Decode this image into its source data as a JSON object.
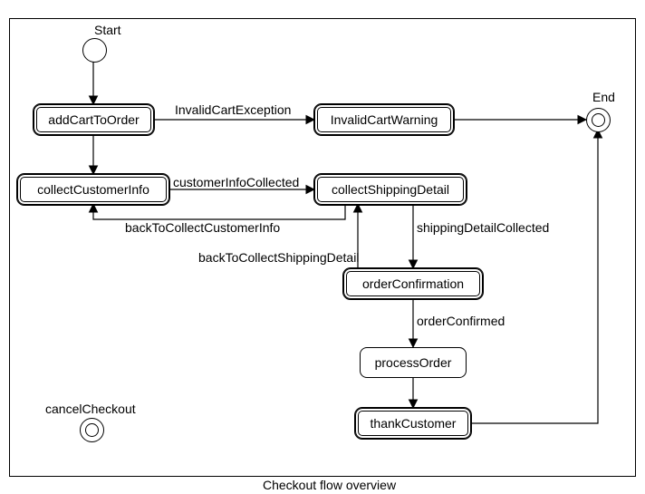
{
  "diagram": {
    "caption": "Checkout flow overview",
    "startLabel": "Start",
    "endLabel": "End",
    "nodes": {
      "addCartToOrder": "addCartToOrder",
      "invalidCartWarning": "InvalidCartWarning",
      "collectCustomerInfo": "collectCustomerInfo",
      "collectShippingDetail": "collectShippingDetail",
      "orderConfirmation": "orderConfirmation",
      "processOrder": "processOrder",
      "thankCustomer": "thankCustomer",
      "cancelCheckout": "cancelCheckout"
    },
    "edges": {
      "invalidCartException": "InvalidCartException",
      "customerInfoCollected": "customerInfoCollected",
      "backToCollectCustomerInfo": "backToCollectCustomerInfo",
      "shippingDetailCollected": "shippingDetailCollected",
      "backToCollectShippingDetail": "backToCollectShippingDetail",
      "orderConfirmed": "orderConfirmed"
    }
  }
}
